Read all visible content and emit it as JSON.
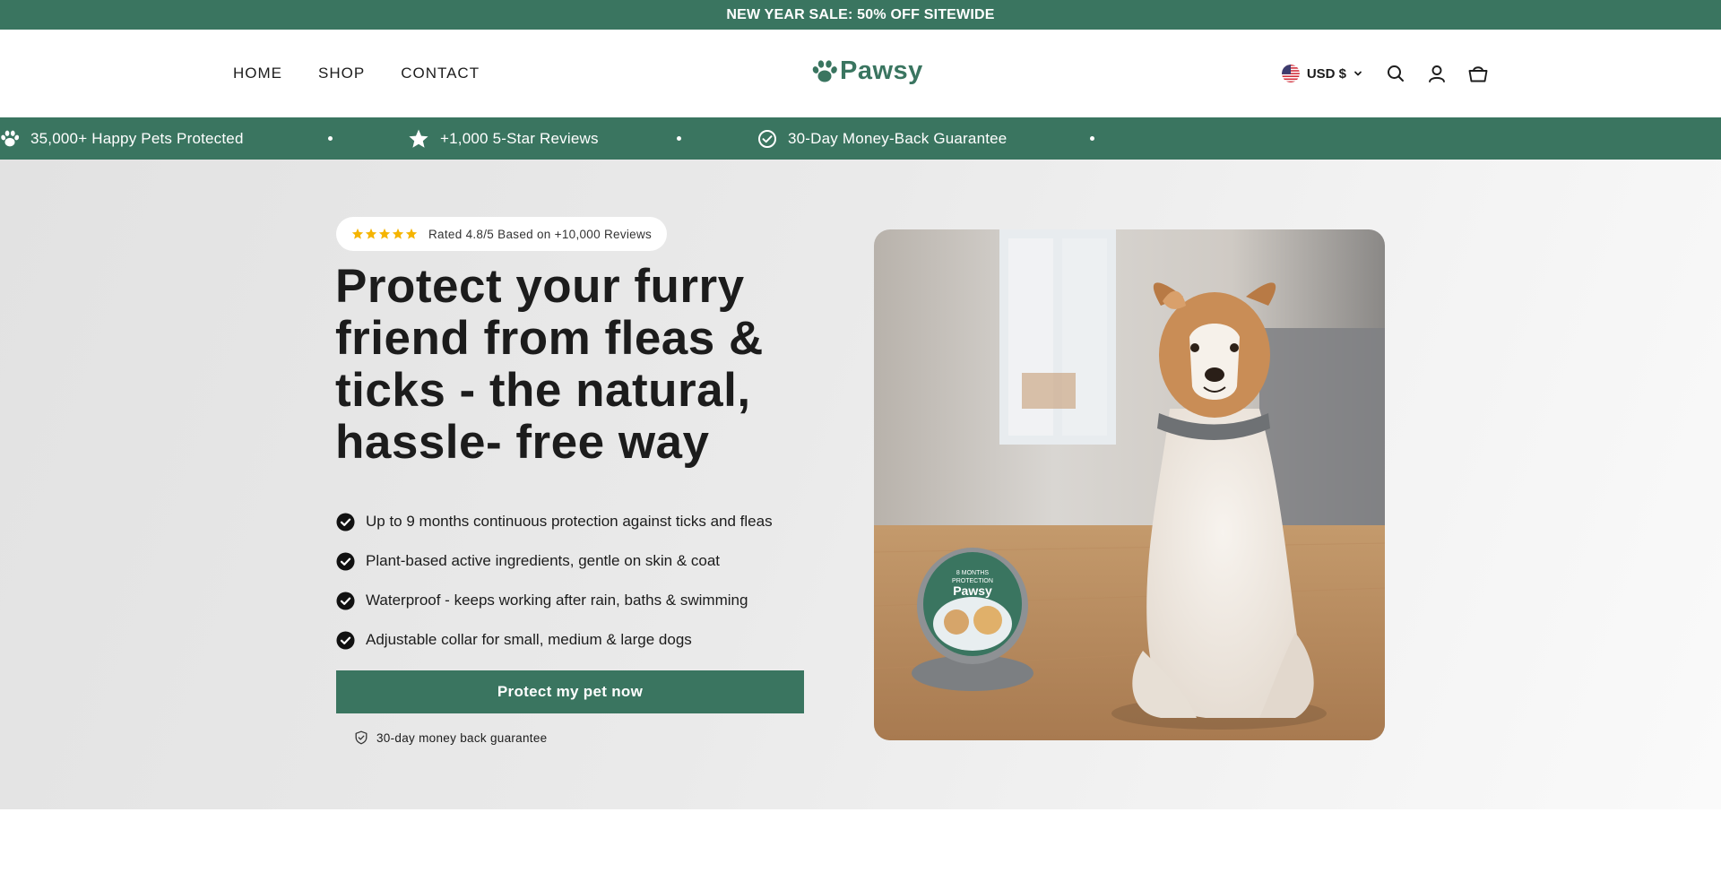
{
  "announcement": {
    "text": "NEW YEAR SALE: 50% OFF SITEWIDE"
  },
  "nav": {
    "items": [
      {
        "label": "HOME"
      },
      {
        "label": "SHOP"
      },
      {
        "label": "CONTACT"
      }
    ]
  },
  "logo": {
    "text": "Pawsy",
    "icon": "paw-icon"
  },
  "header": {
    "currency": {
      "label": "USD $",
      "flag": "us-flag-icon"
    },
    "icons": [
      "search-icon",
      "account-icon",
      "cart-icon"
    ]
  },
  "trust_bar": {
    "items": [
      {
        "label": "35,000+ Happy Pets Protected",
        "icon": "paw-icon"
      },
      {
        "label": "+1,000 5-Star Reviews",
        "icon": "star-icon"
      },
      {
        "label": "30-Day Money-Back Guarantee",
        "icon": "check-circle-icon"
      }
    ]
  },
  "hero": {
    "rating": {
      "stars": 5,
      "text": "Rated 4.8/5 Based on +10,000 Reviews"
    },
    "headline": "Protect your furry friend from fleas & ticks - the natural, hassle- free way",
    "benefits": [
      "Up to 9 months continuous protection against ticks and fleas",
      "Plant-based active ingredients, gentle on skin & coat",
      "Waterproof - keeps working after rain, baths & swimming",
      "Adjustable collar for small, medium & large dogs"
    ],
    "cta_label": "Protect my pet now",
    "guarantee_text": "30-day money back guarantee",
    "image": {
      "product_lid_line1": "8 MONTHS",
      "product_lid_line2": "PROTECTION",
      "product_brand": "Pawsy"
    }
  },
  "colors": {
    "brand_green": "#3a7560",
    "star_yellow": "#f5b400",
    "hero_bg": "#e8e8e8"
  }
}
